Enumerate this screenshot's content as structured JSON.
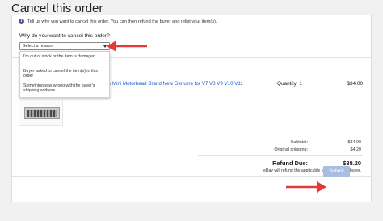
{
  "page": {
    "title": "Cancel this order",
    "info_text": "Tell us why you want to cancel this order. You can then refund the buyer and relist your item(s)."
  },
  "reason": {
    "question": "Why do you want to cancel this order?",
    "selected": "Select a reason",
    "options": [
      "I'm out of stock or the item is damaged",
      "Buyer asked to cancel the item(s) in this order",
      "Something was wrong with the buyer's shipping address"
    ]
  },
  "item": {
    "title": "elease Mini Motorhead Brand New Genuine for V7 V8 V9 V10 V11",
    "quantity": "Quantity: 1",
    "price": "$34.00"
  },
  "summary": {
    "subtotal_label": "Subtotal:",
    "subtotal_value": "$34.00",
    "shipping_label": "Original shipping:",
    "shipping_value": "$4.20",
    "refund_label": "Refund Due:",
    "refund_value": "$38.20",
    "tax_note": "eBay will refund the applicable tax back to the buyer."
  },
  "actions": {
    "submit_label": "Submit"
  },
  "colors": {
    "annotation_arrow": "#e53935",
    "link": "#1a56c4",
    "submit_disabled": "#a9bde0"
  }
}
